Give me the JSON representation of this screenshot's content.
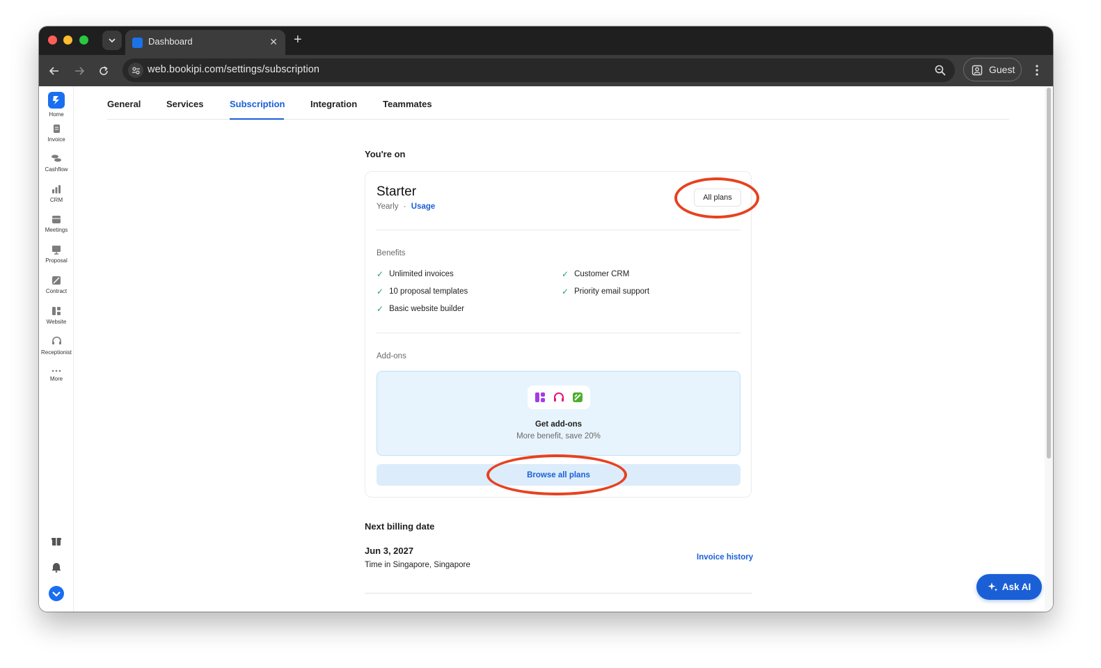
{
  "browser": {
    "tab_title": "Dashboard",
    "url": "web.bookipi.com/settings/subscription",
    "profile_label": "Guest"
  },
  "sidebar": {
    "items": [
      {
        "label": "Home",
        "icon": "bookipi-logo-icon"
      },
      {
        "label": "Invoice",
        "icon": "invoice-icon"
      },
      {
        "label": "Cashflow",
        "icon": "cashflow-icon"
      },
      {
        "label": "CRM",
        "icon": "crm-icon"
      },
      {
        "label": "Meetings",
        "icon": "meetings-icon"
      },
      {
        "label": "Proposal",
        "icon": "proposal-icon"
      },
      {
        "label": "Contract",
        "icon": "contract-icon"
      },
      {
        "label": "Website",
        "icon": "website-icon"
      },
      {
        "label": "Receptionist",
        "icon": "receptionist-icon"
      },
      {
        "label": "More",
        "icon": "more-dots-icon"
      }
    ],
    "bottom_icons": [
      "gift-icon",
      "bell-icon",
      "chevron-badge-icon"
    ]
  },
  "settings_tabs": [
    "General",
    "Services",
    "Subscription",
    "Integration",
    "Teammates"
  ],
  "active_tab": "Subscription",
  "plan": {
    "section_label": "You're on",
    "name": "Starter",
    "billing_cycle": "Yearly",
    "separator": "·",
    "usage_link": "Usage",
    "all_plans_button": "All plans",
    "benefits_label": "Benefits",
    "benefits": [
      "Unlimited invoices",
      "Customer CRM",
      "10 proposal templates",
      "Priority email support",
      "Basic website builder"
    ],
    "addons_label": "Add-ons",
    "addons_title": "Get add-ons",
    "addons_subtitle": "More benefit, save 20%",
    "browse_button": "Browse all plans"
  },
  "billing": {
    "section_label": "Next billing date",
    "date": "Jun 3, 2027",
    "timezone": "Time in Singapore, Singapore",
    "invoice_history_link": "Invoice history"
  },
  "ask_ai_button": "Ask AI",
  "colors": {
    "accent": "#1a5fd6",
    "check": "#21a366",
    "annotation": "#e8411f",
    "addon_bg": "#e7f4fd"
  }
}
